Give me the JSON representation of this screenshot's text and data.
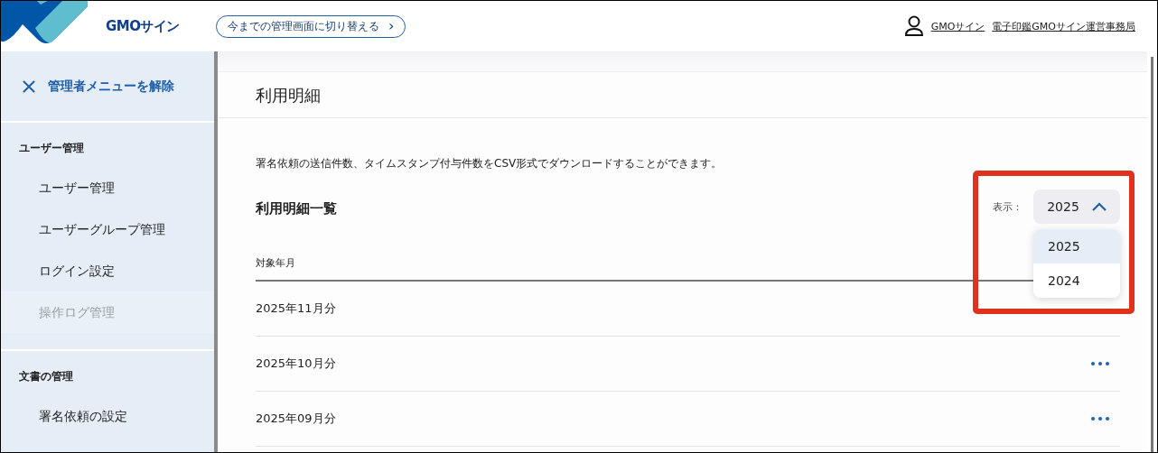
{
  "header": {
    "logo": "GMOサイン",
    "switch_button": "今までの管理画面に切り替える",
    "switch_icon": "›",
    "user_links": [
      "GMOサイン",
      "電子印鑑GMOサイン運営事務局"
    ]
  },
  "sidebar": {
    "close_label": "管理者メニューを解除",
    "sections": [
      {
        "title": "ユーザー管理",
        "items": [
          {
            "label": "ユーザー管理",
            "disabled": false
          },
          {
            "label": "ユーザーグループ管理",
            "disabled": false
          },
          {
            "label": "ログイン設定",
            "disabled": false
          },
          {
            "label": "操作ログ管理",
            "disabled": true
          }
        ]
      },
      {
        "title": "文書の管理",
        "items": [
          {
            "label": "署名依頼の設定",
            "disabled": false
          }
        ]
      }
    ]
  },
  "page": {
    "title": "利用明細",
    "description": "署名依頼の送信件数、タイムスタンプ付与件数をCSV形式でダウンロードすることができます。",
    "list_title": "利用明細一覧",
    "filter": {
      "label": "表示：",
      "value": "2025",
      "expanded": true,
      "options": [
        {
          "label": "2025",
          "selected": true
        },
        {
          "label": "2024",
          "selected": false
        }
      ],
      "highlighted": true
    },
    "table": {
      "columns": [
        "対象年月"
      ],
      "rows": [
        {
          "month": "2025年11月分",
          "menu": false
        },
        {
          "month": "2025年10月分",
          "menu": true
        },
        {
          "month": "2025年09月分",
          "menu": true
        }
      ]
    }
  }
}
